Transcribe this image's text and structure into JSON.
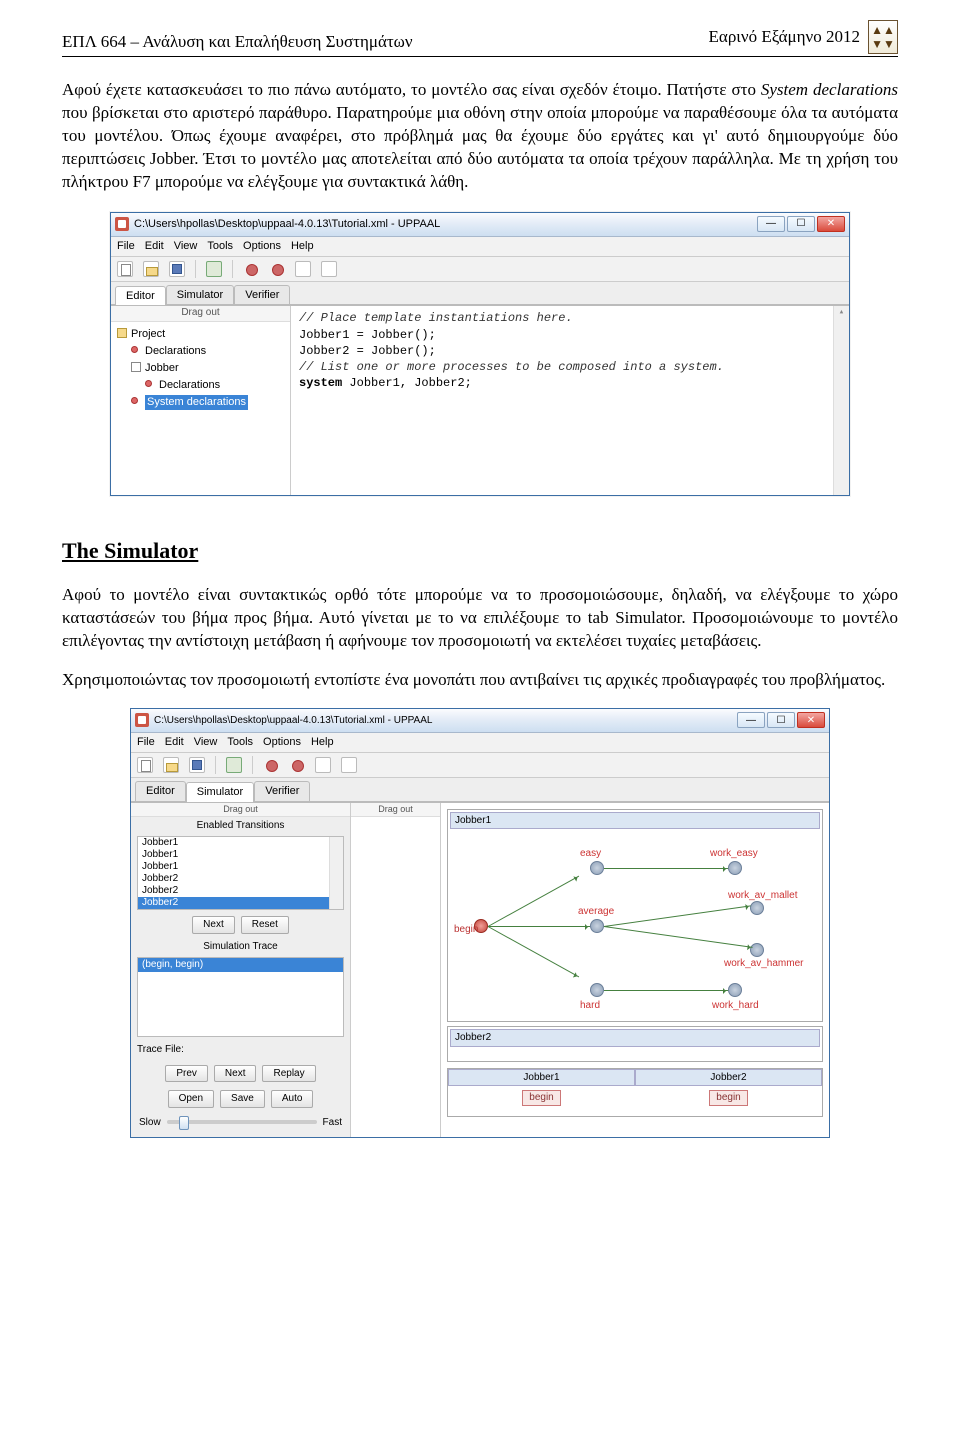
{
  "header": {
    "left": "ΕΠΛ 664 – Ανάλυση και Επαλήθευση Συστημάτων",
    "right": "Εαρινό Εξάμηνο 2012"
  },
  "para1_a": "Αφού έχετε κατασκευάσει το πιο πάνω αυτόματο, το μοντέλο σας είναι σχεδόν έτοιμο. Πατήστε στο ",
  "para1_i": "System declarations",
  "para1_b": " που βρίσκεται στο αριστερό παράθυρο. Παρατηρούμε μια οθόνη στην οποία μπορούμε να παραθέσουμε όλα τα αυτόματα του μοντέλου. Όπως έχουμε αναφέρει, στο πρόβλημά μας θα έχουμε δύο εργάτες και γι' αυτό δημιουργούμε δύο περιπτώσεις Jobber. Έτσι το μοντέλο μας αποτελείται από δύο αυτόματα τα οποία τρέχουν παράλληλα. Με τη χρήση του πλήκτρου F7 μπορούμε να ελέγξουμε για συντακτικά λάθη.",
  "shot1": {
    "title": "C:\\Users\\hpollas\\Desktop\\uppaal-4.0.13\\Tutorial.xml - UPPAAL",
    "menus": [
      "File",
      "Edit",
      "View",
      "Tools",
      "Options",
      "Help"
    ],
    "tabs": [
      "Editor",
      "Simulator",
      "Verifier"
    ],
    "drag": "Drag out",
    "tree": {
      "project": "Project",
      "decl": "Declarations",
      "template": "Jobber",
      "tmpl_decl": "Declarations",
      "sysdecl": "System declarations"
    },
    "code": {
      "l1": "// Place template instantiations here.",
      "l2": "Jobber1 = Jobber();",
      "l3": "Jobber2 = Jobber();",
      "l4": "",
      "l5": "// List one or more processes to be composed into a system.",
      "l6a": "system",
      "l6b": " Jobber1, Jobber2;"
    }
  },
  "section": "The Simulator",
  "para2": "Αφού το μοντέλο είναι συντακτικώς ορθό τότε μπορούμε να το προσομοιώσουμε, δηλαδή, να ελέγξουμε το χώρο καταστάσεών του βήμα προς βήμα. Αυτό γίνεται με το να επιλέξουμε το tab Simulator. Προσομοιώνουμε το μοντέλο επιλέγοντας την αντίστοιχη μετάβαση ή αφήνουμε τον προσομοιωτή να εκτελέσει τυχαίες μεταβάσεις.",
  "para3": "Χρησιμοποιώντας τον προσομοιωτή εντοπίστε ένα μονοπάτι που αντιβαίνει τις αρχικές προδιαγραφές του προβλήματος.",
  "shot2": {
    "title": "C:\\Users\\hpollas\\Desktop\\uppaal-4.0.13\\Tutorial.xml - UPPAAL",
    "menus": [
      "File",
      "Edit",
      "View",
      "Tools",
      "Options",
      "Help"
    ],
    "tabs": [
      "Editor",
      "Simulator",
      "Verifier"
    ],
    "drag": "Drag out",
    "enabled_title": "Enabled Transitions",
    "enabled_items": [
      "Jobber1",
      "Jobber1",
      "Jobber1",
      "Jobber2",
      "Jobber2",
      "Jobber2"
    ],
    "btn_next": "Next",
    "btn_reset": "Reset",
    "simtrace_title": "Simulation Trace",
    "simtrace_row": "(begin, begin)",
    "tracefile": "Trace File:",
    "btn_prev": "Prev",
    "btn_next2": "Next",
    "btn_replay": "Replay",
    "btn_open": "Open",
    "btn_save": "Save",
    "btn_auto": "Auto",
    "slow": "Slow",
    "fast": "Fast",
    "graph": {
      "frame": "Jobber1",
      "begin": "begin",
      "average": "average",
      "easy": "easy",
      "hard": "hard",
      "work_easy": "work_easy",
      "work_av_mallet": "work_av_mallet",
      "work_av_hammer": "work_av_hammer",
      "work_hard": "work_hard",
      "frame2": "Jobber2"
    },
    "seq": {
      "col1": "Jobber1",
      "col2": "Jobber2",
      "val": "begin"
    }
  }
}
